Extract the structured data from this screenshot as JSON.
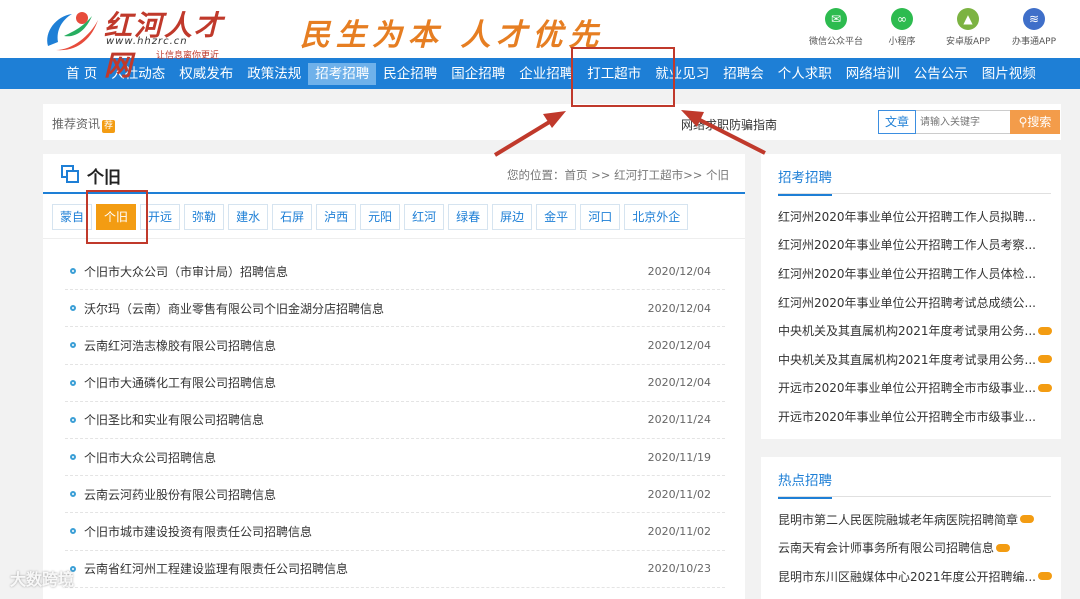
{
  "header": {
    "logo_text": "红河人才网",
    "logo_url": "www.hhzrc.cn",
    "logo_tagline": "让信息离你更近",
    "slogan": "民生为本 人才优先",
    "apps": [
      {
        "label": "微信公众平台",
        "icon": "wechat-icon",
        "color": "#2dbb4f",
        "glyph": "✉"
      },
      {
        "label": "小程序",
        "icon": "miniprogram-icon",
        "color": "#2dbb4f",
        "glyph": "∞"
      },
      {
        "label": "安卓版APP",
        "icon": "android-icon",
        "color": "#7cb342",
        "glyph": "▲"
      },
      {
        "label": "办事通APP",
        "icon": "service-app-icon",
        "color": "#3f6fc9",
        "glyph": "≋"
      }
    ]
  },
  "nav": {
    "items": [
      "首 页",
      "人社动态",
      "权威发布",
      "政策法规",
      "招考招聘",
      "民企招聘",
      "国企招聘",
      "企业招聘",
      "打工超市",
      "就业见习",
      "招聘会",
      "个人求职",
      "网络培训",
      "公告公示",
      "图片视频"
    ],
    "active_index": 4
  },
  "recommend": {
    "label": "推荐资讯",
    "hot_badge": "荐",
    "news": "网络求职防骗指南",
    "search_type": "文章",
    "search_placeholder": "请输入关键字",
    "search_button": "搜索"
  },
  "main": {
    "title": "个旧",
    "breadcrumb": "您的位置：首页 >> 红河打工超市>> 个旧",
    "cities": [
      "蒙自",
      "个旧",
      "开远",
      "弥勒",
      "建水",
      "石屏",
      "泸西",
      "元阳",
      "红河",
      "绿春",
      "屏边",
      "金平",
      "河口",
      "北京外企"
    ],
    "active_city_index": 1,
    "rows": [
      {
        "title": "个旧市大众公司（市审计局）招聘信息",
        "date": "2020/12/04"
      },
      {
        "title": "沃尔玛（云南）商业零售有限公司个旧金湖分店招聘信息",
        "date": "2020/12/04"
      },
      {
        "title": "云南红河浩志橡胶有限公司招聘信息",
        "date": "2020/12/04"
      },
      {
        "title": "个旧市大通磷化工有限公司招聘信息",
        "date": "2020/12/04"
      },
      {
        "title": "个旧圣比和实业有限公司招聘信息",
        "date": "2020/11/24"
      },
      {
        "title": "个旧市大众公司招聘信息",
        "date": "2020/11/19"
      },
      {
        "title": "云南云河药业股份有限公司招聘信息",
        "date": "2020/11/02"
      },
      {
        "title": "个旧市城市建设投资有限责任公司招聘信息",
        "date": "2020/11/02"
      },
      {
        "title": "云南省红河州工程建设监理有限责任公司招聘信息",
        "date": "2020/10/23"
      }
    ]
  },
  "sidebar": {
    "section1_title": "招考招聘",
    "section1_items": [
      {
        "text": "红河州2020年事业单位公开招聘工作人员拟聘...",
        "new": false
      },
      {
        "text": "红河州2020年事业单位公开招聘工作人员考察...",
        "new": false
      },
      {
        "text": "红河州2020年事业单位公开招聘工作人员体检...",
        "new": false
      },
      {
        "text": "红河州2020年事业单位公开招聘考试总成绩公...",
        "new": false
      },
      {
        "text": "中央机关及其直属机构2021年度考试录用公务...",
        "new": true
      },
      {
        "text": "中央机关及其直属机构2021年度考试录用公务...",
        "new": true
      },
      {
        "text": "开远市2020年事业单位公开招聘全市市级事业...",
        "new": true
      },
      {
        "text": "开远市2020年事业单位公开招聘全市市级事业...",
        "new": false
      }
    ],
    "section2_title": "热点招聘",
    "section2_items": [
      {
        "text": "昆明市第二人民医院融城老年病医院招聘简章",
        "new": true
      },
      {
        "text": "云南天宥会计师事务所有限公司招聘信息",
        "new": true
      },
      {
        "text": "昆明市东川区融媒体中心2021年度公开招聘编...",
        "new": true
      }
    ]
  },
  "watermark": "大数跨境"
}
